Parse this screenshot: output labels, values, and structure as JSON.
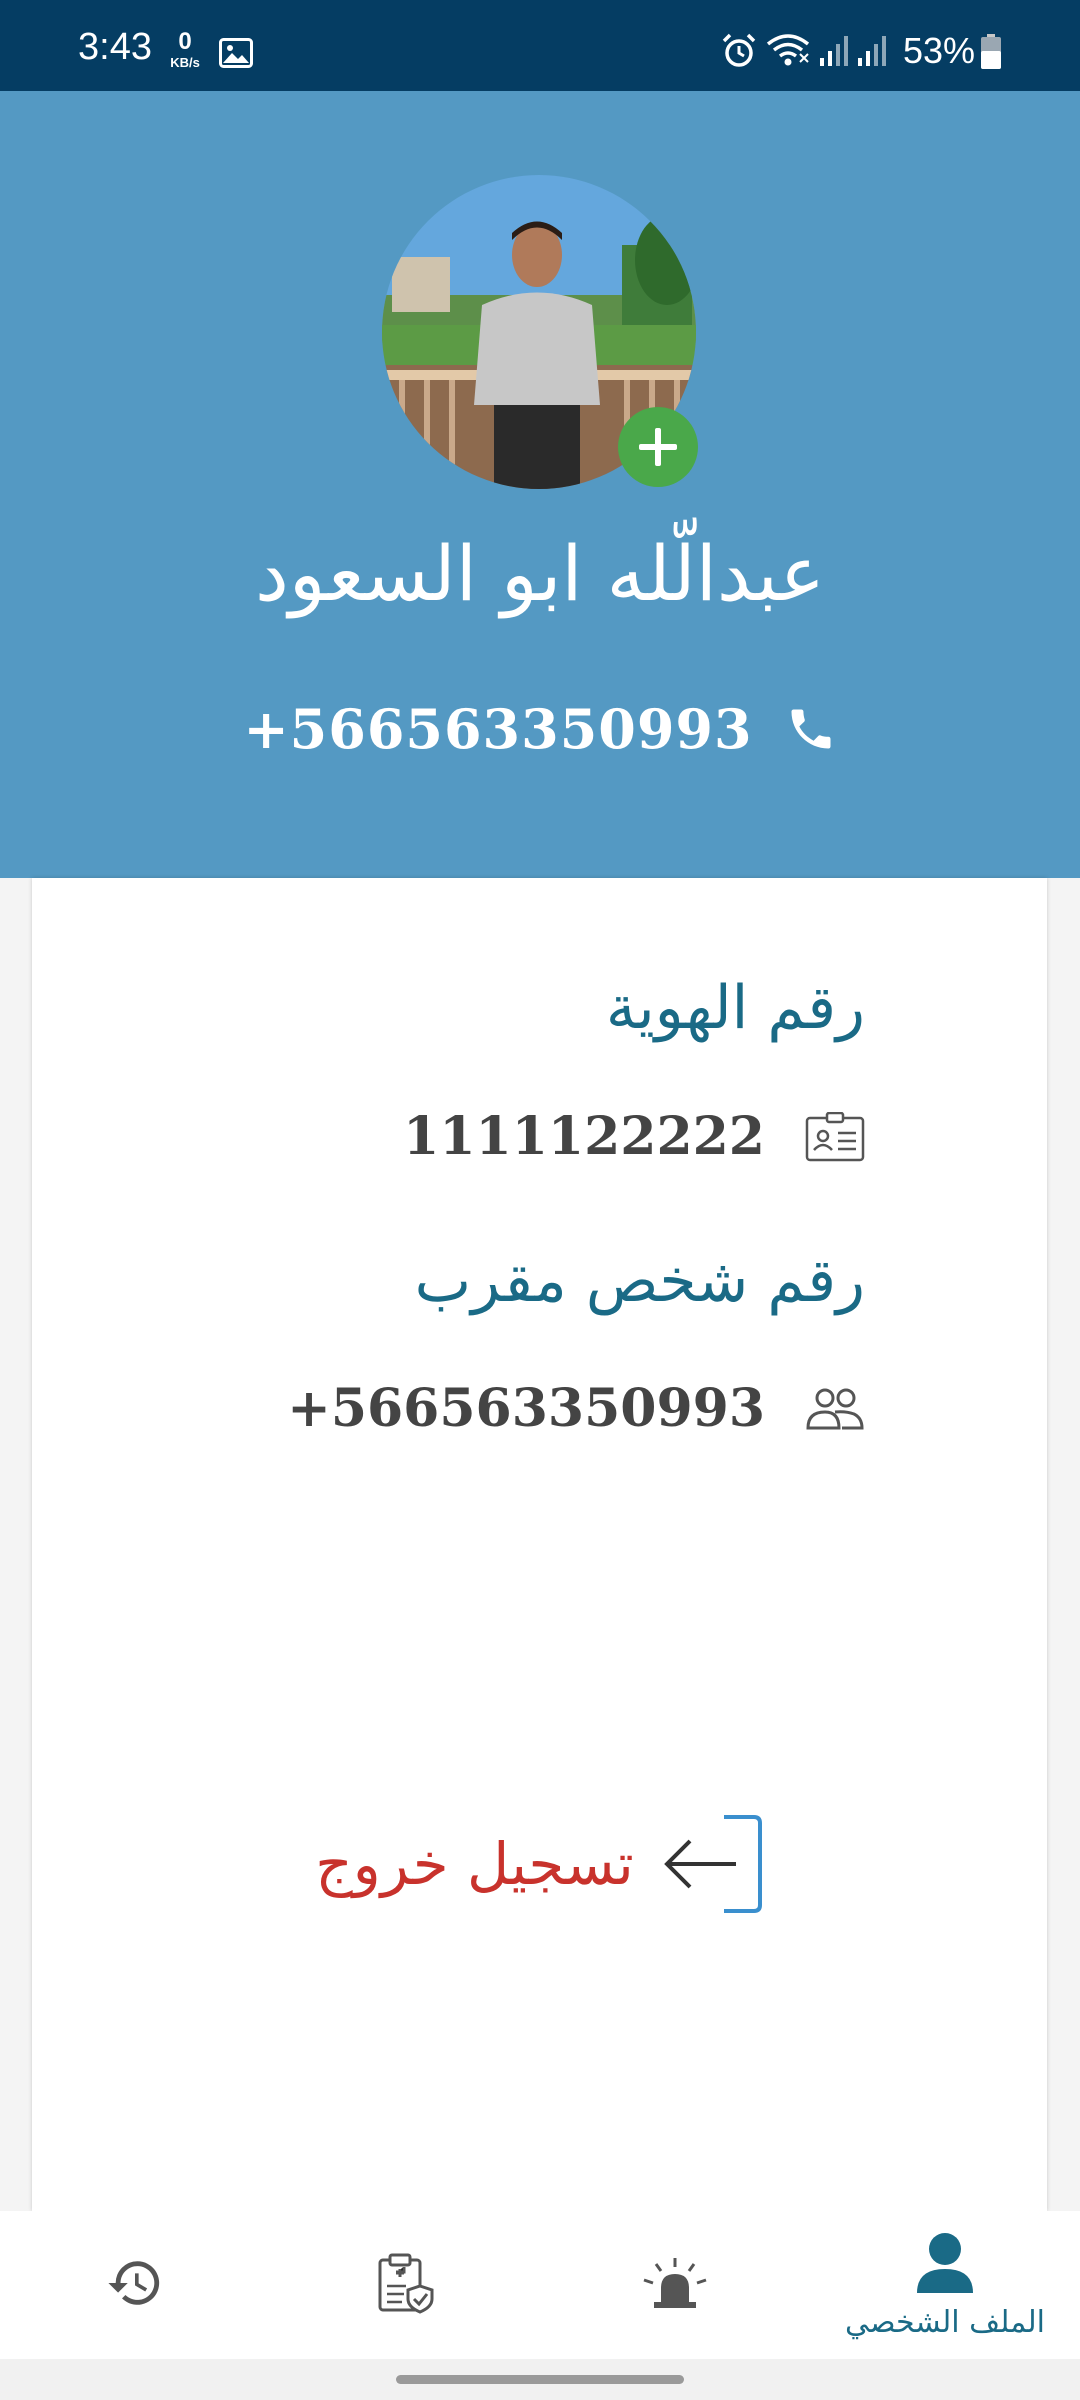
{
  "status_bar": {
    "time": "3:43",
    "net_speed": "0",
    "net_unit": "KB/s",
    "battery_percent": "53%",
    "icons": [
      "gallery-icon",
      "alarm-icon",
      "wifi-icon",
      "signal-icon",
      "signal-icon",
      "battery-icon"
    ]
  },
  "profile": {
    "name": "عبدالّله ابو السعود",
    "phone": "+566563350993",
    "avatar_icon": "avatar",
    "add_photo_icon": "plus-icon"
  },
  "details": {
    "id_label": "رقم الهوية",
    "id_value": "1111122222",
    "id_icon": "id-card-icon",
    "contact_label": "رقم شخص مقرب",
    "contact_value": "+566563350993",
    "contact_icon": "people-icon"
  },
  "logout": {
    "label": "تسجيل خروج",
    "icon": "logout-icon"
  },
  "bottom_nav": {
    "items": [
      {
        "icon": "history-icon",
        "label": ""
      },
      {
        "icon": "medical-report-icon",
        "label": ""
      },
      {
        "icon": "alarm-siren-icon",
        "label": ""
      },
      {
        "icon": "profile-icon",
        "label": "الملف الشخصي",
        "active": true
      }
    ]
  },
  "colors": {
    "status_bar": "#053d63",
    "header": "#5499c3",
    "label_text": "#1a6a86",
    "value_text": "#444444",
    "logout_text": "#c8322c",
    "logout_icon": "#3a8fce",
    "add_button": "#4aa84a",
    "inactive_icon": "#555555",
    "active_icon": "#1a6a86"
  }
}
